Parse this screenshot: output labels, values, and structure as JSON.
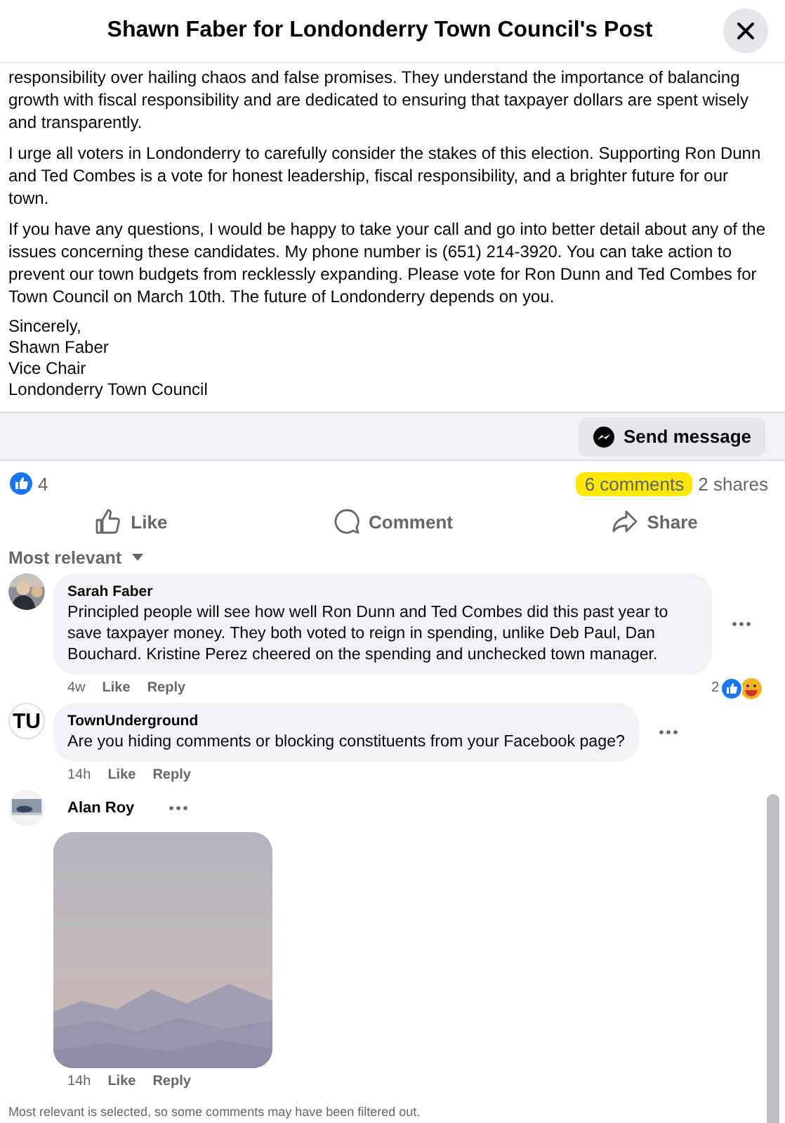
{
  "header": {
    "title": "Shawn Faber for Londonderry Town Council's Post"
  },
  "post": {
    "paragraphs": [
      "responsibility over hailing chaos and false promises. They understand the importance of balancing growth with fiscal responsibility and are dedicated to ensuring that taxpayer dollars are spent wisely and transparently.",
      "I urge all voters in Londonderry to carefully consider the stakes of this election. Supporting Ron Dunn and Ted Combes is a vote for honest leadership, fiscal responsibility, and a brighter future for our town.",
      "If you have any questions, I would be happy to take your call and go into better detail about any of the issues concerning these candidates. My phone number is (651) 214-3920. You can take action to prevent our town budgets from recklessly expanding. Please vote for Ron Dunn and Ted Combes for Town Council on March 10th. The future of Londonderry depends on you."
    ],
    "signature": [
      "Sincerely,",
      "Shawn Faber",
      "Vice Chair",
      "Londonderry Town Council"
    ]
  },
  "send_message": "Send message",
  "stats": {
    "reactions": "4",
    "comments": "6 comments",
    "comments_highlighted": true,
    "shares": "2 shares"
  },
  "actions": [
    {
      "kind": "like",
      "label": "Like"
    },
    {
      "kind": "comment",
      "label": "Comment"
    },
    {
      "kind": "share",
      "label": "Share"
    }
  ],
  "sort": "Most relevant",
  "comments": [
    {
      "kind": "text",
      "author": "Sarah Faber",
      "text": "Principled people will see how well Ron Dunn and Ted Combes did this past year to save taxpayer money. They both voted to reign in spending, unlike Deb Paul, Dan Bouchard. Kristine Perez cheered on the spending and unchecked town manager.",
      "time": "4w",
      "like": "Like",
      "reply": "Reply",
      "reactions": "2"
    },
    {
      "kind": "text",
      "initials": "TU",
      "author": "TownUnderground",
      "text": "Are you hiding comments or blocking constituents from your Facebook page?",
      "time": "14h",
      "like": "Like",
      "reply": "Reply"
    },
    {
      "author": "Alan Roy",
      "time": "14h",
      "like": "Like",
      "reply": "Reply"
    }
  ],
  "footer_note": "Most relevant is selected, so some comments may have been filtered out."
}
